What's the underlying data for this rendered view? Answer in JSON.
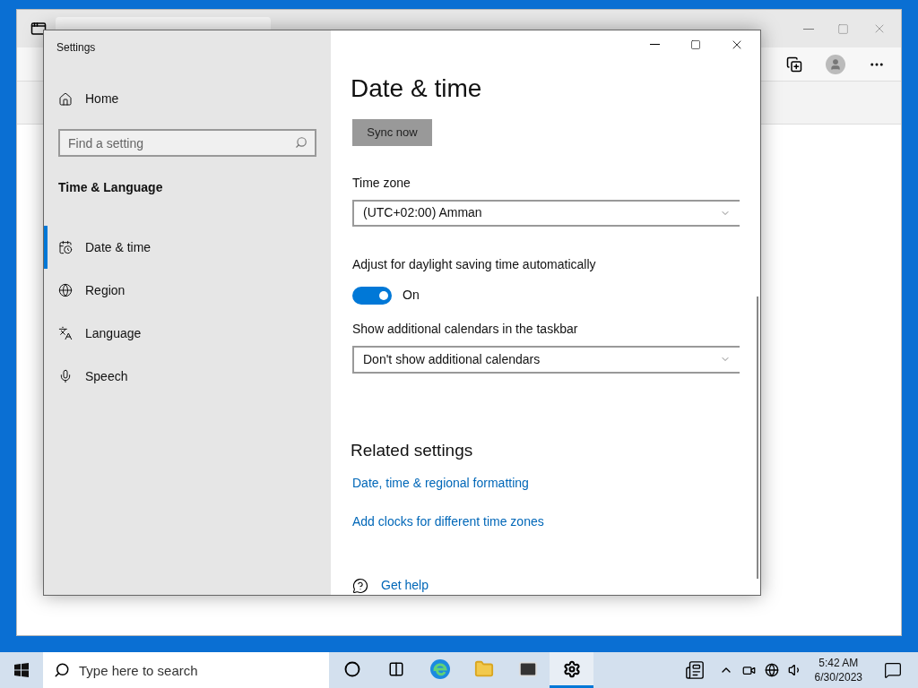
{
  "settings_window": {
    "title": "Settings",
    "sidebar": {
      "home": "Home",
      "search": {
        "placeholder": "Find a setting"
      },
      "section": "Time & Language",
      "items": [
        {
          "label": "Date & time",
          "kind": "calendar",
          "selected": true
        },
        {
          "label": "Region",
          "kind": "globe",
          "selected": false
        },
        {
          "label": "Language",
          "kind": "language",
          "selected": false
        },
        {
          "label": "Speech",
          "kind": "mic",
          "selected": false
        }
      ]
    },
    "page": {
      "title": "Date & time",
      "sync_button": "Sync now",
      "time_zone": {
        "label": "Time zone",
        "value": "(UTC+02:00) Amman"
      },
      "daylight": {
        "label": "Adjust for daylight saving time automatically",
        "on": true,
        "state_text": "On"
      },
      "calendars": {
        "label": "Show additional calendars in the taskbar",
        "value": "Don't show additional calendars"
      },
      "related": {
        "title": "Related settings",
        "links": [
          "Date, time & regional formatting",
          "Add clocks for different time zones"
        ]
      },
      "help": "Get help"
    }
  },
  "taskbar": {
    "search": {
      "placeholder": "Type here to search"
    },
    "apps": [
      {
        "kind": "cortana",
        "selected": false
      },
      {
        "kind": "taskview",
        "selected": false
      },
      {
        "kind": "edge",
        "selected": false
      },
      {
        "kind": "explorer",
        "selected": false
      },
      {
        "kind": "mail",
        "selected": false
      },
      {
        "kind": "settings",
        "selected": true
      }
    ],
    "time": "5:42 AM",
    "date": "6/30/2023"
  }
}
